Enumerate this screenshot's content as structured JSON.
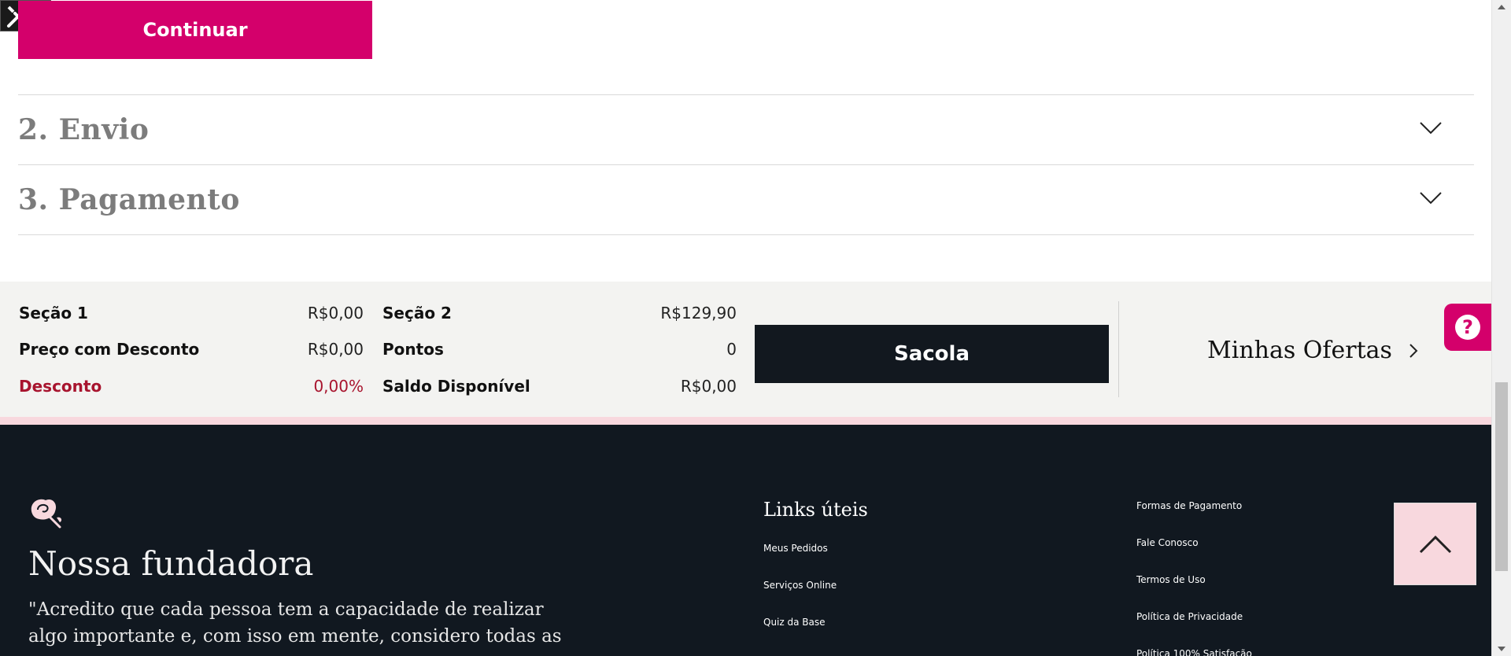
{
  "checkout": {
    "continue_label": "Continuar",
    "steps": [
      {
        "title": "2. Envio"
      },
      {
        "title": "3. Pagamento"
      }
    ]
  },
  "summary": {
    "section1_label": "Seção 1",
    "section1_value": "R$0,00",
    "discount_price_label": "Preço com Desconto",
    "discount_price_value": "R$0,00",
    "discount_label": "Desconto",
    "discount_value": "0,00%",
    "section2_label": "Seção 2",
    "section2_value": "R$129,90",
    "points_label": "Pontos",
    "points_value": "0",
    "balance_label": "Saldo Disponível",
    "balance_value": "R$0,00",
    "bag_label": "Sacola",
    "offers_label": "Minhas Ofertas"
  },
  "help": {
    "icon": "question-icon",
    "glyph": "?"
  },
  "footer": {
    "founder_title": "Nossa fundadora",
    "founder_quote": "\"Acredito que cada pessoa tem a capacidade de realizar algo importante e, com isso em mente, considero todas as",
    "links_title": "Links úteis",
    "links_col1": [
      "Meus Pedidos",
      "Serviços Online",
      "Quiz da Base"
    ],
    "links_col2": [
      "Formas de Pagamento",
      "Fale Conosco",
      "Termos de Uso",
      "Política de Privacidade",
      "Política 100% Satisfação"
    ]
  },
  "colors": {
    "brand_pink": "#d4006b",
    "dark_navy": "#111820",
    "light_pink": "#f8d8de",
    "discount_red": "#a8142e"
  },
  "devtools_badge": {
    "close_glyph": "×"
  }
}
